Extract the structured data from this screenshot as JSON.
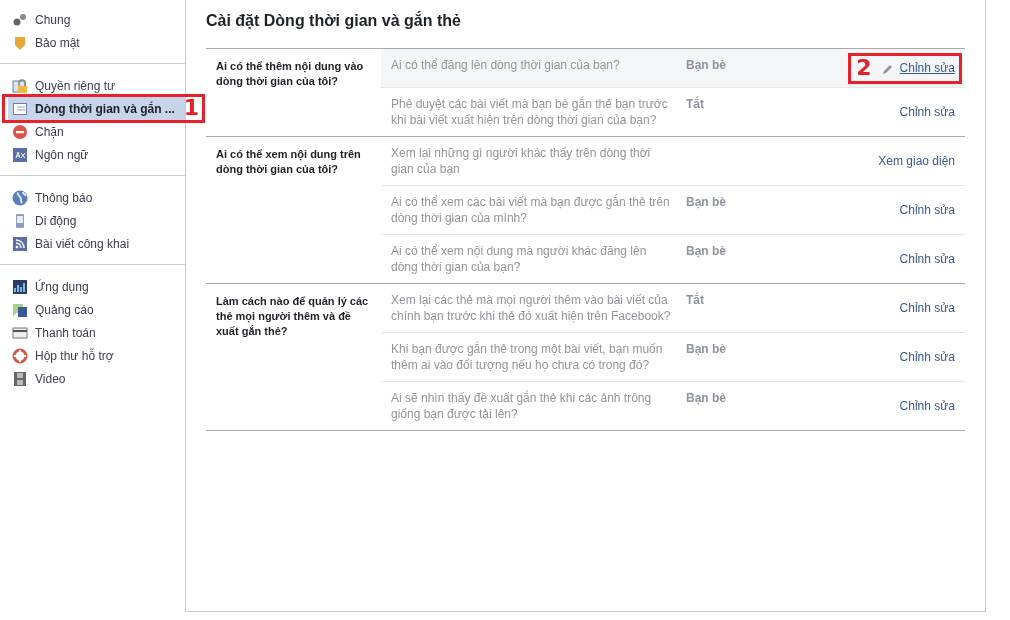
{
  "sidebar": {
    "groups": [
      {
        "items": [
          {
            "label": "Chung",
            "selected": false
          },
          {
            "label": "Bảo mật",
            "selected": false
          }
        ]
      },
      {
        "items": [
          {
            "label": "Quyền riêng tư",
            "selected": false
          },
          {
            "label": "Dòng thời gian và gắn ...",
            "selected": true,
            "annotation": "1"
          },
          {
            "label": "Chặn",
            "selected": false
          },
          {
            "label": "Ngôn ngữ",
            "selected": false
          }
        ]
      },
      {
        "items": [
          {
            "label": "Thông báo",
            "selected": false
          },
          {
            "label": "Di động",
            "selected": false
          },
          {
            "label": "Bài viết công khai",
            "selected": false
          }
        ]
      },
      {
        "items": [
          {
            "label": "Ứng dụng",
            "selected": false
          },
          {
            "label": "Quảng cáo",
            "selected": false
          },
          {
            "label": "Thanh toán",
            "selected": false
          },
          {
            "label": "Hộp thư hỗ trợ",
            "selected": false
          },
          {
            "label": "Video",
            "selected": false
          }
        ]
      }
    ]
  },
  "title": "Cài đặt Dòng thời gian và gắn thẻ",
  "sections": [
    {
      "heading": "Ai có thể thêm nội dung vào dòng thời gian của tôi?",
      "settings": [
        {
          "question": "Ai có thể đăng lên dòng thời gian của bạn?",
          "value": "Bạn bè",
          "action": "Chỉnh sửa",
          "hovered": true,
          "annotation": "2"
        },
        {
          "question": "Phê duyệt các bài viết mà bạn bè gắn thẻ bạn trước khi bài viết xuất hiện trên dòng thời gian của bạn?",
          "value": "Tắt",
          "action": "Chỉnh sửa",
          "hovered": false
        }
      ]
    },
    {
      "heading": "Ai có thể xem nội dung trên dòng thời gian của tôi?",
      "settings": [
        {
          "question": "Xem lại những gì người khác thấy trên dòng thời gian của bạn",
          "action": "Xem giao diện",
          "hovered": false
        },
        {
          "question": "Ai có thể xem các bài viết mà bạn được gắn thẻ trên dòng thời gian của mình?",
          "value": "Bạn bè",
          "action": "Chỉnh sửa",
          "hovered": false
        },
        {
          "question": "Ai có thể xem nội dung mà người khác đăng lên dòng thời gian của bạn?",
          "value": "Bạn bè",
          "action": "Chỉnh sửa",
          "hovered": false
        }
      ]
    },
    {
      "heading": "Làm cách nào để quản lý các thẻ mọi người thêm và đề xuất gắn thẻ?",
      "settings": [
        {
          "question": "Xem lại các thẻ mà mọi người thêm vào bài viết của chính bạn trước khi thẻ đó xuất hiện trên Facebook?",
          "value": "Tắt",
          "action": "Chỉnh sửa",
          "hovered": false
        },
        {
          "question": "Khi bạn được gắn thẻ trong một bài viết, bạn muốn thêm ai vào đối tượng nếu họ chưa có trong đó?",
          "value": "Bạn bè",
          "action": "Chỉnh sửa",
          "hovered": false
        },
        {
          "question": "Ai sẽ nhìn thấy đề xuất gắn thẻ khi các ảnh trông giống bạn được tải lên?",
          "value": "Bạn bè",
          "action": "Chỉnh sửa",
          "hovered": false
        }
      ]
    }
  ]
}
